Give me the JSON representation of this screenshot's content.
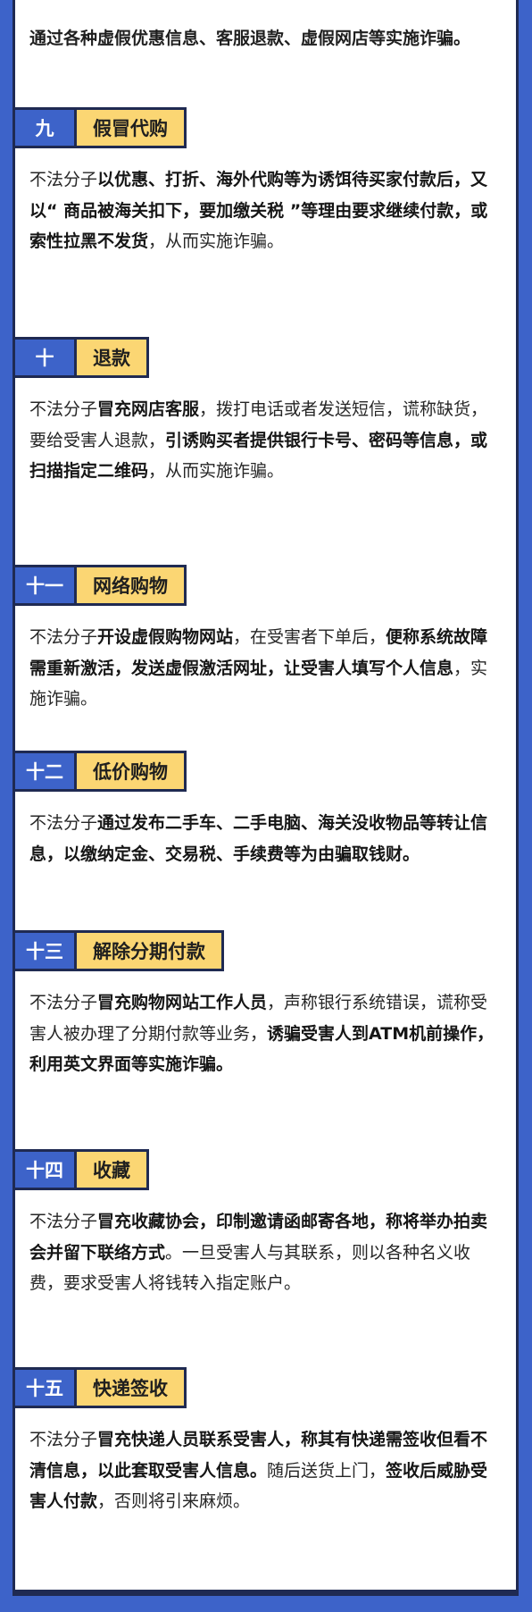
{
  "intro": "通过各种虚假优惠信息、客服退款、虚假网店等实施诈骗。",
  "sections": [
    {
      "num": "九",
      "title": "假冒代购",
      "parts": [
        {
          "t": " 不法分子",
          "b": false
        },
        {
          "t": "以优惠、打折、海外代购等为诱饵待买家付款后，又以“ 商品被海关扣下，要加缴关税 ”等理由要求继续付款，或索性拉黑不发货",
          "b": true
        },
        {
          "t": "，从而实施诈骗。",
          "b": false
        }
      ]
    },
    {
      "num": "十",
      "title": "退款",
      "parts": [
        {
          "t": "不法分子",
          "b": false
        },
        {
          "t": "冒充网店客服",
          "b": true
        },
        {
          "t": "，拨打电话或者发送短信，谎称缺货，要给受害人退款，",
          "b": false
        },
        {
          "t": "引诱购买者提供银行卡号、密码等信息，或扫描指定二维码",
          "b": true
        },
        {
          "t": "，从而实施诈骗。",
          "b": false
        }
      ]
    },
    {
      "num": "十一",
      "title": "网络购物",
      "parts": [
        {
          "t": "不法分子",
          "b": false
        },
        {
          "t": "开设虚假购物网站",
          "b": true
        },
        {
          "t": "，在受害者下单后，",
          "b": false
        },
        {
          "t": "便称系统故障需重新激活，发送虚假激活网址，让受害人填写个人信息",
          "b": true
        },
        {
          "t": "，实施诈骗。",
          "b": false
        }
      ]
    },
    {
      "num": "十二",
      "title": "低价购物",
      "parts": [
        {
          "t": "不法分子",
          "b": false
        },
        {
          "t": "通过发布二手车、二手电脑、海关没收物品等转让信息，以缴纳定金、交易税、手续费等为由骗取钱财。",
          "b": true
        }
      ]
    },
    {
      "num": "十三",
      "title": "解除分期付款",
      "parts": [
        {
          "t": "不法分子",
          "b": false
        },
        {
          "t": "冒充购物网站工作人员",
          "b": true
        },
        {
          "t": "，声称银行系统错误，谎称受害人被办理了分期付款等业务，",
          "b": false
        },
        {
          "t": "诱骗受害人到ATM机前操作，",
          "b": true
        },
        {
          "t": " ",
          "b": false
        },
        {
          "t": "利用英文界面等实施诈骗。",
          "b": true
        }
      ]
    },
    {
      "num": "十四",
      "title": "收藏",
      "parts": [
        {
          "t": "不法分子",
          "b": false
        },
        {
          "t": "冒充收藏协会，印制邀请函邮寄各地，称将举办拍卖会并留下联络方式",
          "b": true
        },
        {
          "t": "。一旦受害人与其联系，则以各种名义收费，要求受害人将钱转入指定账户。",
          "b": false
        }
      ]
    },
    {
      "num": "十五",
      "title": "快递签收",
      "parts": [
        {
          "t": "不法分子",
          "b": false
        },
        {
          "t": "冒充快递人员联系受害人，称其有快递需签收但看不清信息，以此套取受害人信息。",
          "b": true
        },
        {
          "t": "随后送货上门，",
          "b": false
        },
        {
          "t": "签收后威胁受害人付款",
          "b": true
        },
        {
          "t": "，否则将引来麻烦。",
          "b": false
        }
      ]
    }
  ]
}
